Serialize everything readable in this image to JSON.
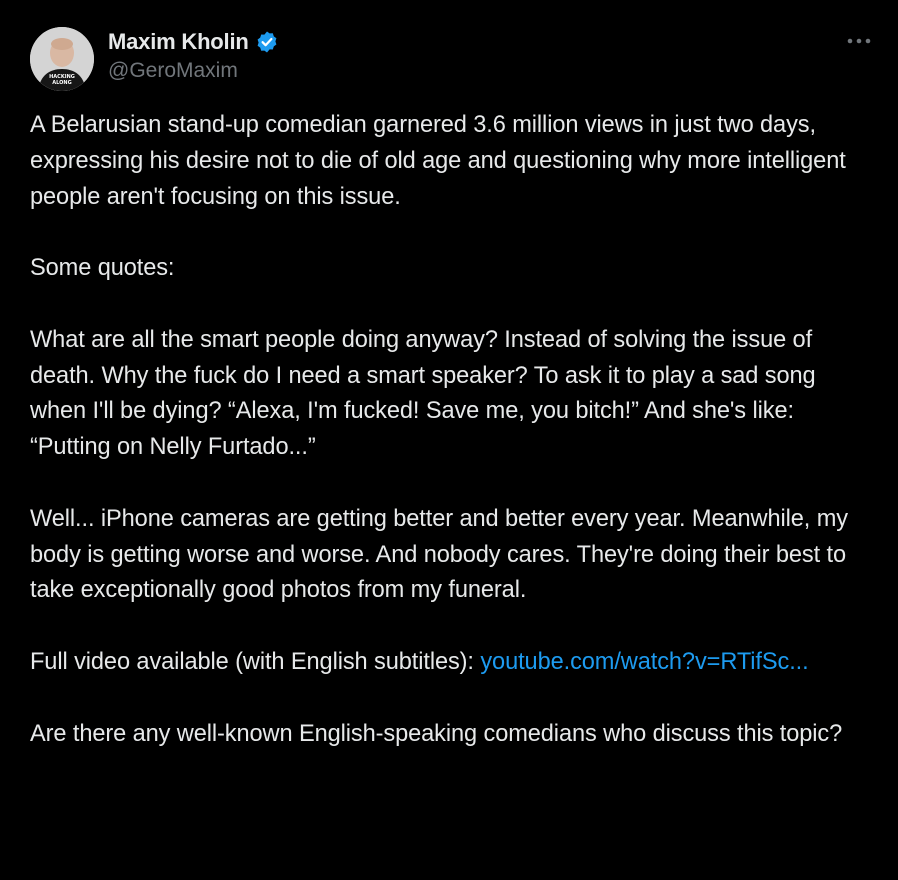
{
  "author": {
    "display_name": "Maxim Kholin",
    "handle": "@GeroMaxim",
    "verified_badge": "verified-check-icon",
    "avatar_shirt_text": "HACKING ALONG",
    "badge_color": "#1d9bf0"
  },
  "menu": {
    "icon": "more-horizontal-icon"
  },
  "tweet": {
    "paragraph_1": "A Belarusian stand-up comedian garnered 3.6 million views in just two days,  expressing his desire not to die of old age and questioning why more intelligent people aren't focusing on this issue.",
    "paragraph_2": "Some quotes:",
    "paragraph_3": "What are all the smart people doing anyway? Instead of solving the issue of death. Why the fuck do I need a smart speaker? To ask it to play a sad song when I'll be dying? “Alexa, I'm fucked! Save me, you bitch!” And she's like: “Putting on Nelly Furtado...”",
    "paragraph_4": "Well... iPhone cameras are getting better and better every year. Meanwhile, my body is getting worse and worse. And nobody cares. They're doing their best to take exceptionally good photos from my funeral.",
    "paragraph_5_prefix": "Full video available (with English subtitles): ",
    "paragraph_5_link": "youtube.com/watch?v=RTifSc...",
    "paragraph_6": "Are there any well-known English-speaking comedians who discuss this topic?"
  },
  "colors": {
    "background": "#000000",
    "text": "#e7e9ea",
    "secondary_text": "#71767b",
    "link": "#1d9bf0"
  }
}
